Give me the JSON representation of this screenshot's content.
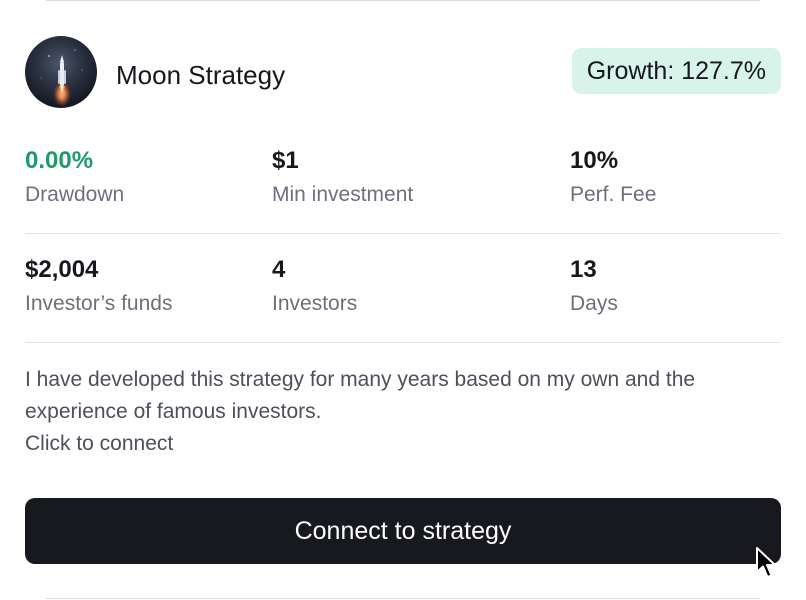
{
  "strategy": {
    "name": "Moon Strategy",
    "avatar_icon": "rocket-launch-avatar",
    "growth_label": "Growth: 127.7%"
  },
  "stats": [
    {
      "value": "0.00%",
      "label": "Drawdown",
      "value_color": "#1f9a6a"
    },
    {
      "value": "$1",
      "label": "Min investment"
    },
    {
      "value": "10%",
      "label": "Perf. Fee"
    },
    {
      "value": "$2,004",
      "label": "Investor’s funds"
    },
    {
      "value": "4",
      "label": "Investors"
    },
    {
      "value": "13",
      "label": "Days"
    }
  ],
  "description": {
    "line1": "I have developed this strategy for many years based on my own and the",
    "line2": "experience of famous investors.",
    "line3": "Click to connect"
  },
  "button": {
    "label": "Connect to strategy"
  },
  "colors": {
    "badge_bg": "#d7f3ea",
    "button_bg": "#17191e",
    "positive": "#1f9a6a",
    "muted_text": "#6c707a"
  },
  "icons": {
    "pointer": "cursor-arrow-icon"
  }
}
